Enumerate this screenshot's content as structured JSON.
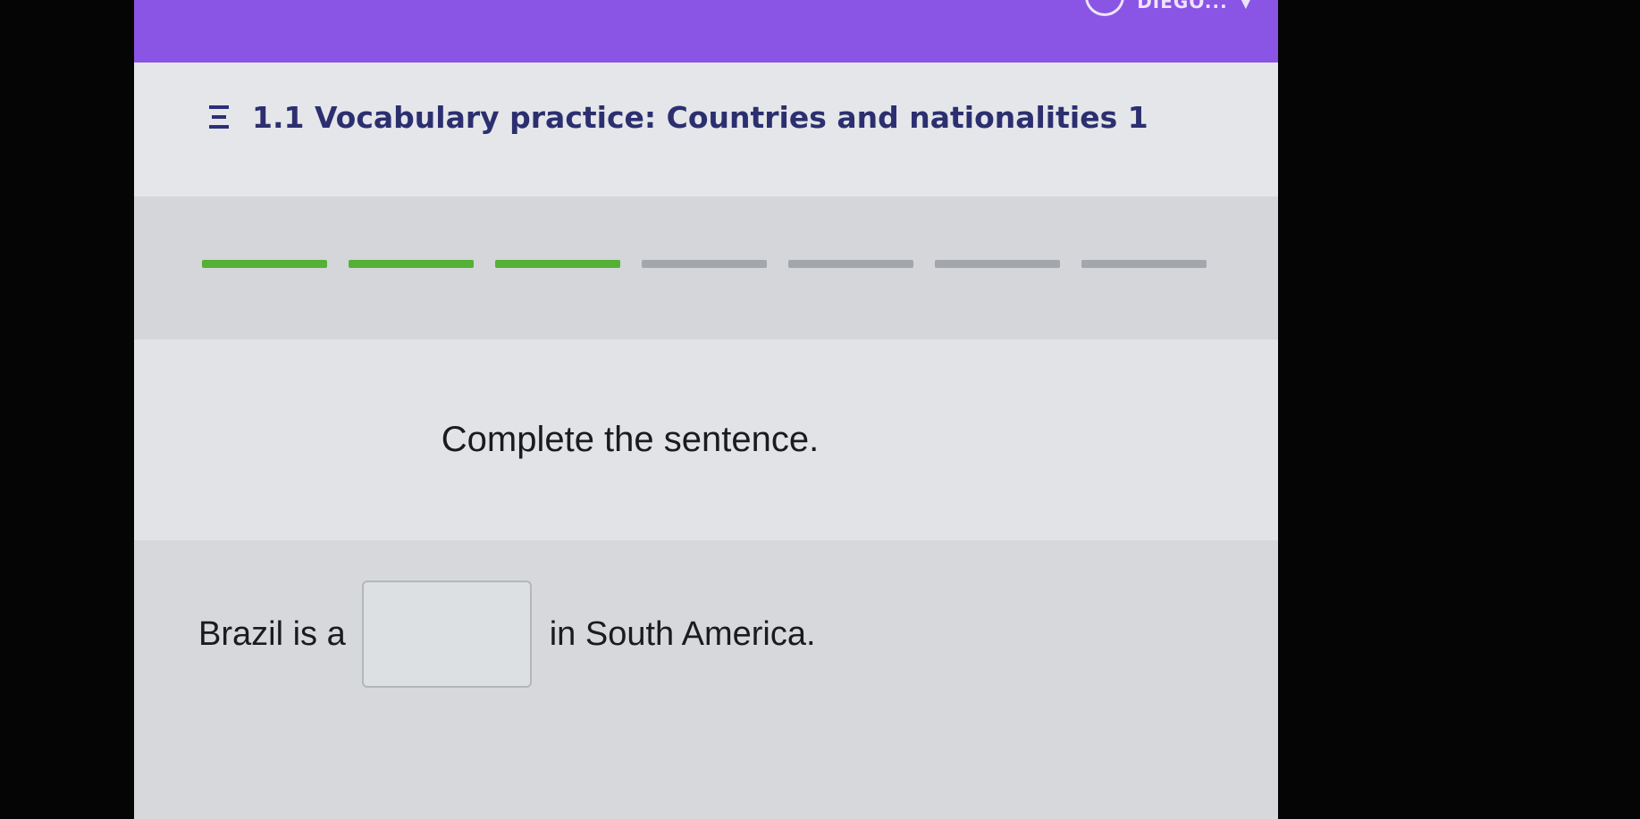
{
  "header": {
    "username": "DIEGO...",
    "accent_color": "#8a54e4",
    "avatar_icon": "user-avatar-icon",
    "dropdown_icon": "chevron-down-icon"
  },
  "activity": {
    "menu_icon": "menu-icon",
    "title": "1.1 Vocabulary practice: Countries and nationalities 1"
  },
  "progress": {
    "total_segments": 7,
    "completed_segments": 3,
    "completed_color": "#54b135",
    "pending_color": "#a3a6ab"
  },
  "question": {
    "instruction": "Complete the sentence.",
    "prefix": "Brazil is a",
    "answer_value": "",
    "suffix": "in South America."
  }
}
